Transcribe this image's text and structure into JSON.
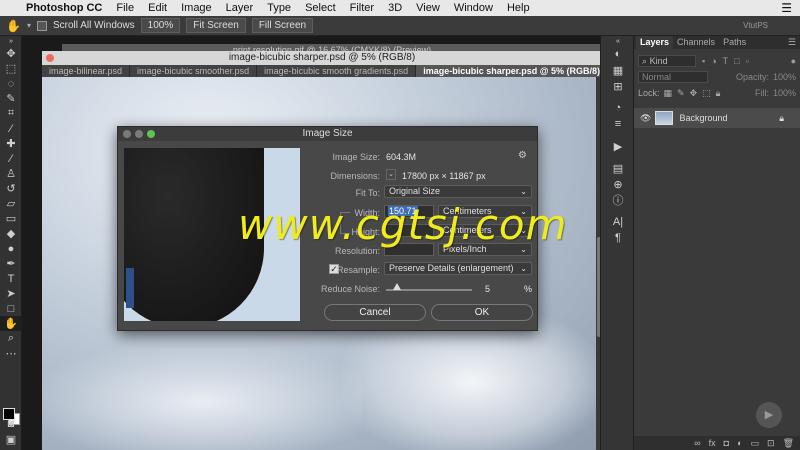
{
  "menubar": {
    "app_name": "Photoshop CC",
    "items": [
      "File",
      "Edit",
      "Image",
      "Layer",
      "Type",
      "Select",
      "Filter",
      "3D",
      "View",
      "Window",
      "Help"
    ]
  },
  "options": {
    "scroll_all": "Scroll All Windows",
    "zoom_100": "100%",
    "fit_screen": "Fit Screen",
    "fill_screen": "Fill Screen",
    "workspace": "VtutPS"
  },
  "documents": {
    "background_title": "print resolution.gif @ 16.67% (CMYK/8) (Preview)",
    "window_title": "image-bicubic sharper.psd @ 5% (RGB/8)",
    "tabs": [
      {
        "label": "image-bilinear.psd"
      },
      {
        "label": "image-bicubic smoother.psd"
      },
      {
        "label": "image-bicubic smooth gradients.psd"
      },
      {
        "label": "image-bicubic sharper.psd @ 5% (RGB/8)"
      }
    ]
  },
  "dialog": {
    "title": "Image Size",
    "image_size_label": "Image Size:",
    "image_size_value": "604.3M",
    "dimensions_label": "Dimensions:",
    "dimensions_value": "17800 px × 11867 px",
    "fit_to_label": "Fit To:",
    "fit_to_value": "Original Size",
    "width_label": "Width:",
    "width_value": "150.71",
    "width_unit": "Centimeters",
    "height_label": "Height:",
    "height_unit": "Centimeters",
    "resolution_label": "Resolution:",
    "resolution_unit": "Pixels/Inch",
    "resample_label": "Resample:",
    "resample_value": "Preserve Details (enlargement)",
    "reduce_noise_label": "Reduce Noise:",
    "reduce_noise_value": "5",
    "reduce_noise_unit": "%",
    "cancel": "Cancel",
    "ok": "OK"
  },
  "watermark": "www.cgtsj.com",
  "layers_panel": {
    "tabs": [
      "Layers",
      "Channels",
      "Paths"
    ],
    "kind_label": "Kind",
    "blend_mode": "Normal",
    "opacity_label": "Opacity:",
    "opacity_value": "100%",
    "lock_label": "Lock:",
    "fill_label": "Fill:",
    "fill_value": "100%",
    "layer_name": "Background"
  },
  "colors": {
    "accent": "#3d6db4",
    "watermark": "#f0ec1a"
  }
}
